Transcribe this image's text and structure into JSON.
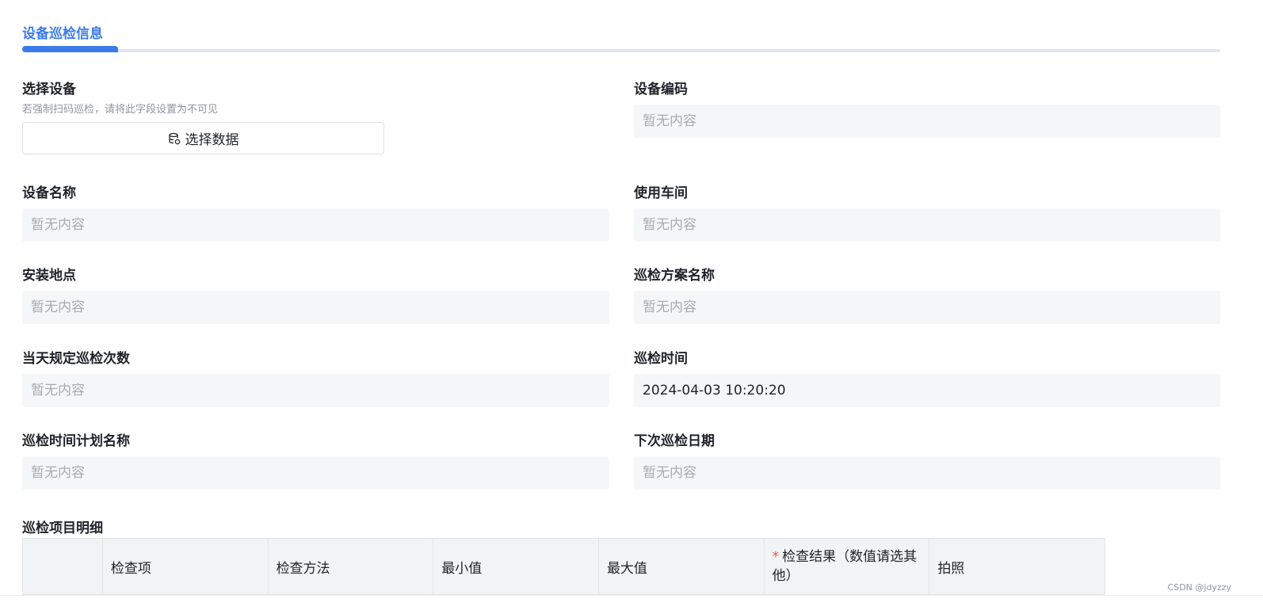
{
  "section": {
    "title": "设备巡检信息"
  },
  "fields": {
    "select_device": {
      "label": "选择设备",
      "desc": "若强制扫码巡检，请将此字段设置为不可见",
      "button_label": "选择数据"
    },
    "device_code": {
      "label": "设备编码",
      "value": "暂无内容"
    },
    "device_name": {
      "label": "设备名称",
      "value": "暂无内容"
    },
    "workshop": {
      "label": "使用车间",
      "value": "暂无内容"
    },
    "install_location": {
      "label": "安装地点",
      "value": "暂无内容"
    },
    "plan_name": {
      "label": "巡检方案名称",
      "value": "暂无内容"
    },
    "daily_count": {
      "label": "当天规定巡检次数",
      "value": "暂无内容"
    },
    "inspect_time": {
      "label": "巡检时间",
      "value": "2024-04-03 10:20:20"
    },
    "schedule_name": {
      "label": "巡检时间计划名称",
      "value": "暂无内容"
    },
    "next_date": {
      "label": "下次巡检日期",
      "value": "暂无内容"
    }
  },
  "table": {
    "title": "巡检项目明细",
    "columns": [
      "",
      "检查项",
      "检查方法",
      "最小值",
      "最大值",
      "检查结果（数值请选其他）",
      "拍照"
    ],
    "required_mark": "*"
  },
  "watermark": "CSDN @jdyzzy"
}
